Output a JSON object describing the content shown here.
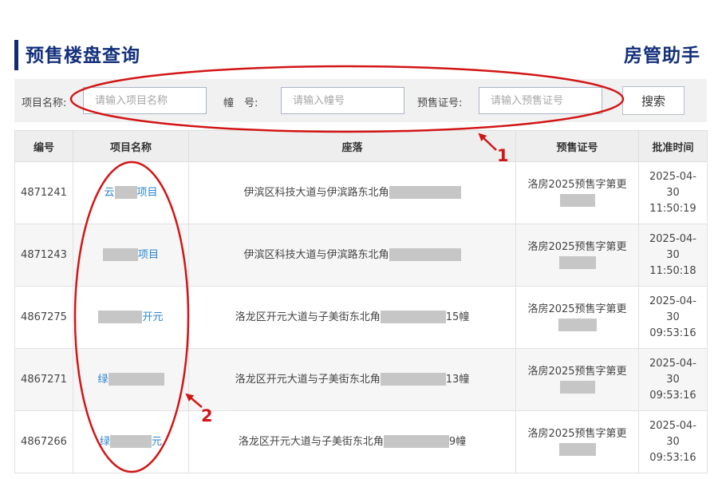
{
  "header": {
    "title": "预售楼盘查询",
    "brand": "房管助手"
  },
  "search": {
    "project_label": "项目名称:",
    "project_placeholder": "请输入项目名称",
    "building_label": "幢　号:",
    "building_placeholder": "请输入幢号",
    "license_label": "预售证号:",
    "license_placeholder": "请输入预售证号",
    "button_label": "搜索"
  },
  "table": {
    "columns": [
      "编号",
      "项目名称",
      "座落",
      "预售证号",
      "批准时间"
    ],
    "rows": [
      {
        "id": "4871241",
        "project_pre": "云",
        "project_post": "项目",
        "location_pre": "伊滨区科技大道与伊滨路东北角",
        "location_post": "",
        "license": "洛房2025预售字第更",
        "date": "2025-04-",
        "day": "30",
        "time": "11:50:19"
      },
      {
        "id": "4871243",
        "project_pre": "",
        "project_post": "项目",
        "location_pre": "伊滨区科技大道与伊滨路东北角",
        "location_post": "",
        "license": "洛房2025预售字第更",
        "date": "2025-04-",
        "day": "30",
        "time": "11:50:18"
      },
      {
        "id": "4867275",
        "project_pre": "",
        "project_post": "开元",
        "location_pre": "洛龙区开元大道与子美街东北角",
        "location_post": "15幢",
        "license": "洛房2025预售字第更",
        "date": "2025-04-",
        "day": "30",
        "time": "09:53:16"
      },
      {
        "id": "4867271",
        "project_pre": "绿",
        "project_post": "",
        "location_pre": "洛龙区开元大道与子美街东北角",
        "location_post": "13幢",
        "license": "洛房2025预售字第更",
        "date": "2025-04-",
        "day": "30",
        "time": "09:53:16"
      },
      {
        "id": "4867266",
        "project_pre": "绿",
        "project_post": "元",
        "location_pre": "洛龙区开元大道与子美街东北角",
        "location_post": "9幢",
        "license": "洛房2025预售字第更",
        "date": "2025-04-",
        "day": "30",
        "time": "09:53:16"
      }
    ]
  },
  "annotations": {
    "label_1": "1",
    "label_2": "2",
    "color": "#d21515"
  },
  "colors": {
    "title": "#13307b",
    "link": "#2a86d1",
    "header_bg": "#eeeeee",
    "search_bg": "#f1f1f1"
  }
}
